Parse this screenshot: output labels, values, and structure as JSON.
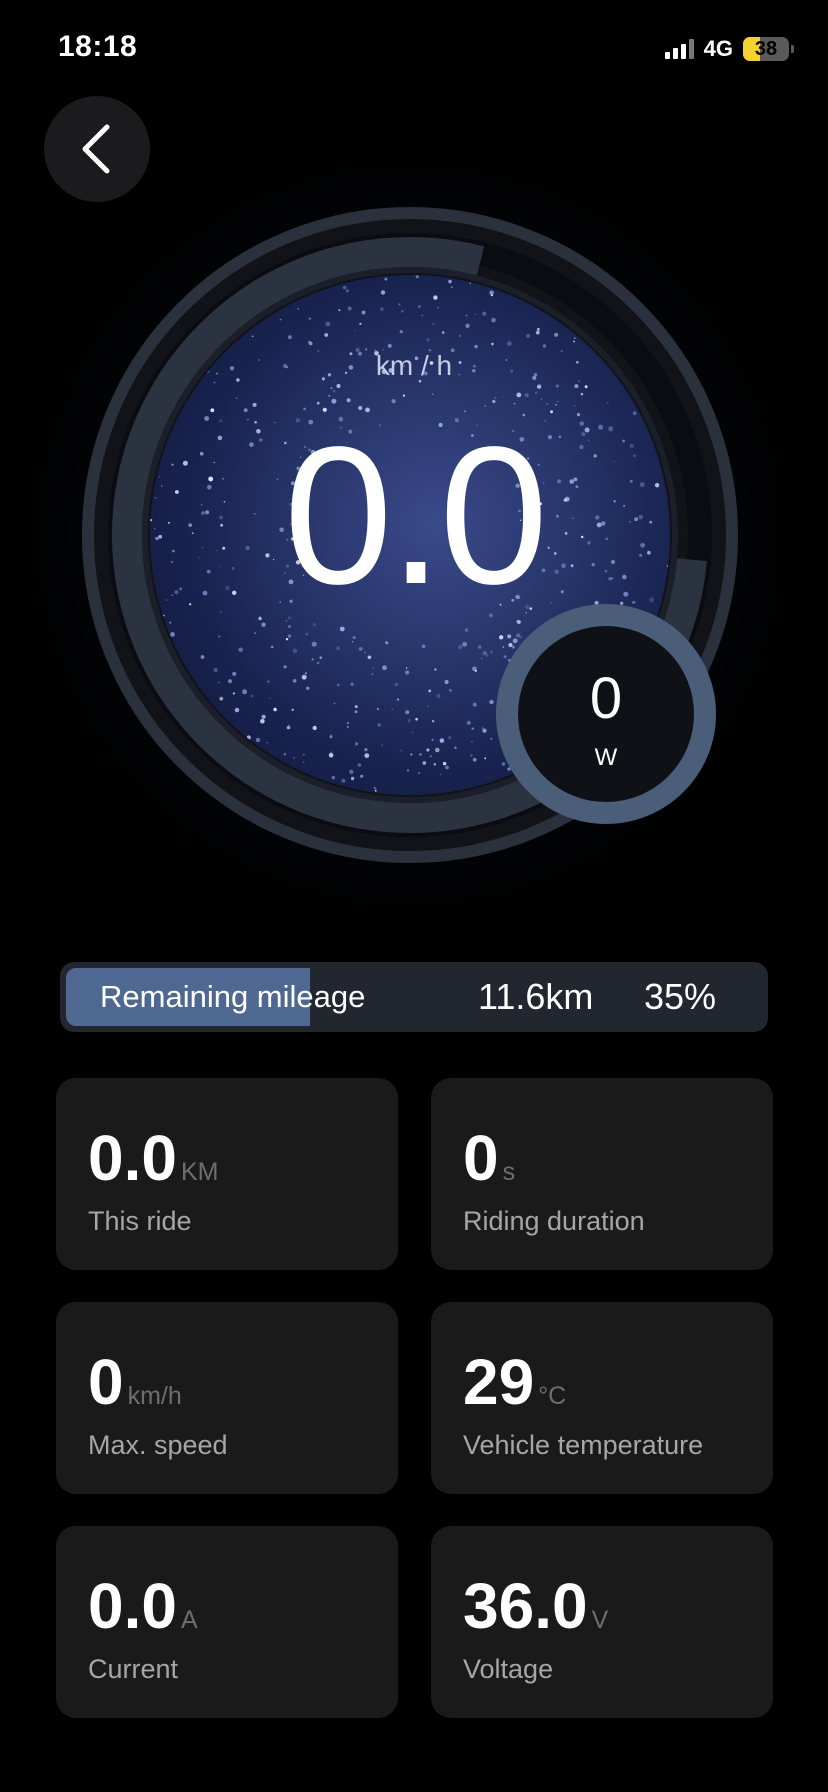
{
  "status_bar": {
    "time": "18:18",
    "network": "4G",
    "battery": "38",
    "battery_color": "#f5d132"
  },
  "header": {
    "back_icon": "chevron-left-icon"
  },
  "gauge": {
    "speed_unit": "km / h",
    "speed_value": "0.0",
    "power_value": "0",
    "power_unit": "W",
    "accent_color": "#4a5e79"
  },
  "mileage": {
    "label": "Remaining mileage",
    "distance": "11.6km",
    "percent": "35%",
    "fill_fraction": 0.35,
    "fill_color": "#4f6891"
  },
  "stats": [
    {
      "value": "0.0",
      "unit": "KM",
      "label": "This ride"
    },
    {
      "value": "0",
      "unit": "s",
      "label": "Riding duration"
    },
    {
      "value": "0",
      "unit": "km/h",
      "label": "Max. speed"
    },
    {
      "value": "29",
      "unit": "°C",
      "label": "Vehicle temperature"
    },
    {
      "value": "0.0",
      "unit": "A",
      "label": "Current"
    },
    {
      "value": "36.0",
      "unit": "V",
      "label": "Voltage"
    }
  ]
}
